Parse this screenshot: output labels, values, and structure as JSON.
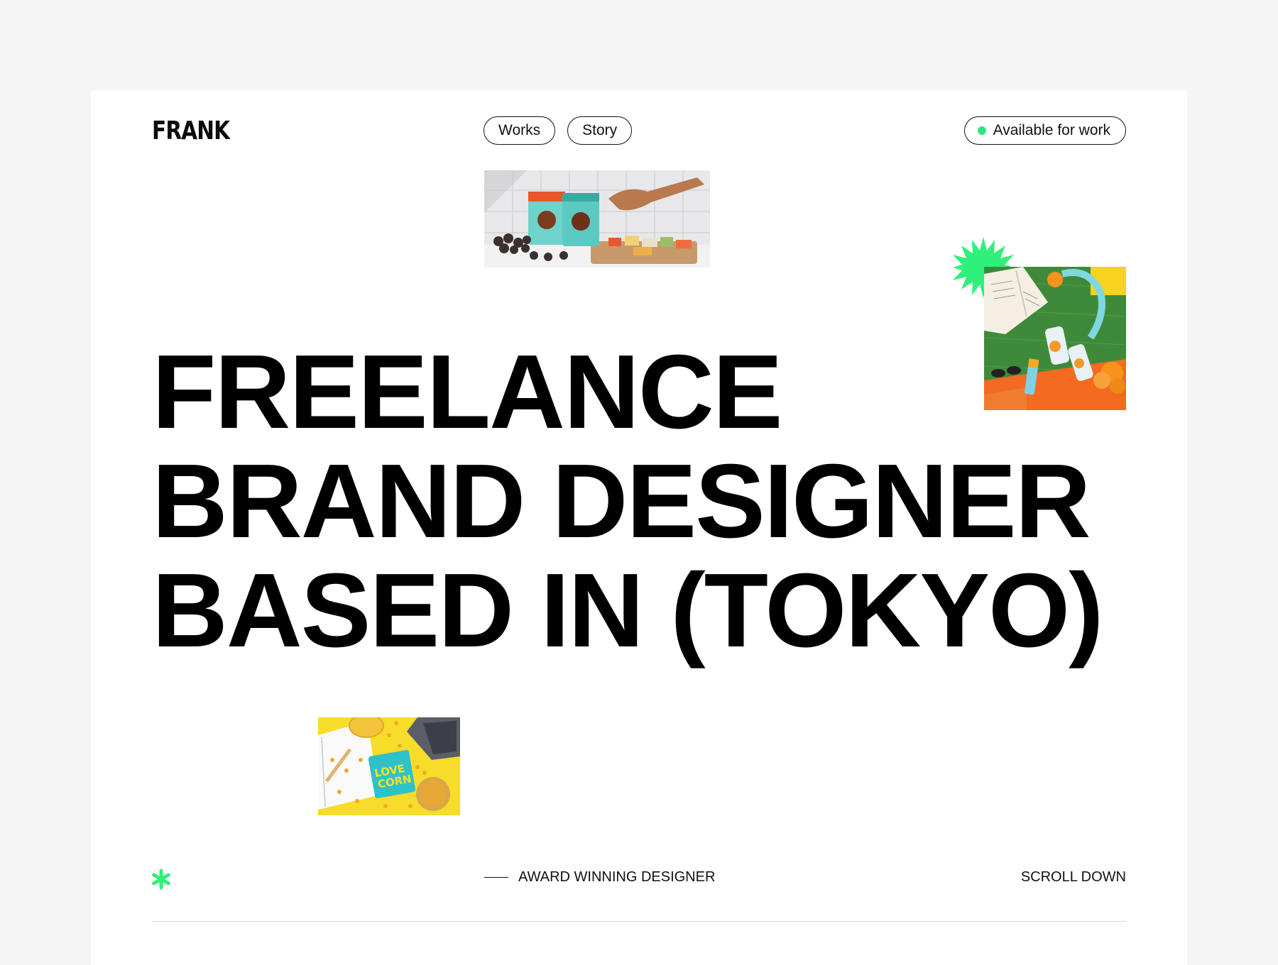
{
  "brand": {
    "logo": "FRANK"
  },
  "nav": {
    "items": [
      {
        "label": "Works"
      },
      {
        "label": "Story"
      }
    ]
  },
  "status": {
    "label": "Available for work",
    "dot_color": "#2ee87b"
  },
  "hero": {
    "lines": [
      "FREELANCE",
      "BRAND DESIGNER",
      "BASED IN (TOKYO)"
    ]
  },
  "footer_bar": {
    "award_label": "AWARD WINNING DESIGNER",
    "scroll_label": "SCROLL DOWN",
    "accent_color": "#2ee87b"
  },
  "icons": {
    "burst": "starburst-icon",
    "asterisk": "asterisk-icon"
  }
}
